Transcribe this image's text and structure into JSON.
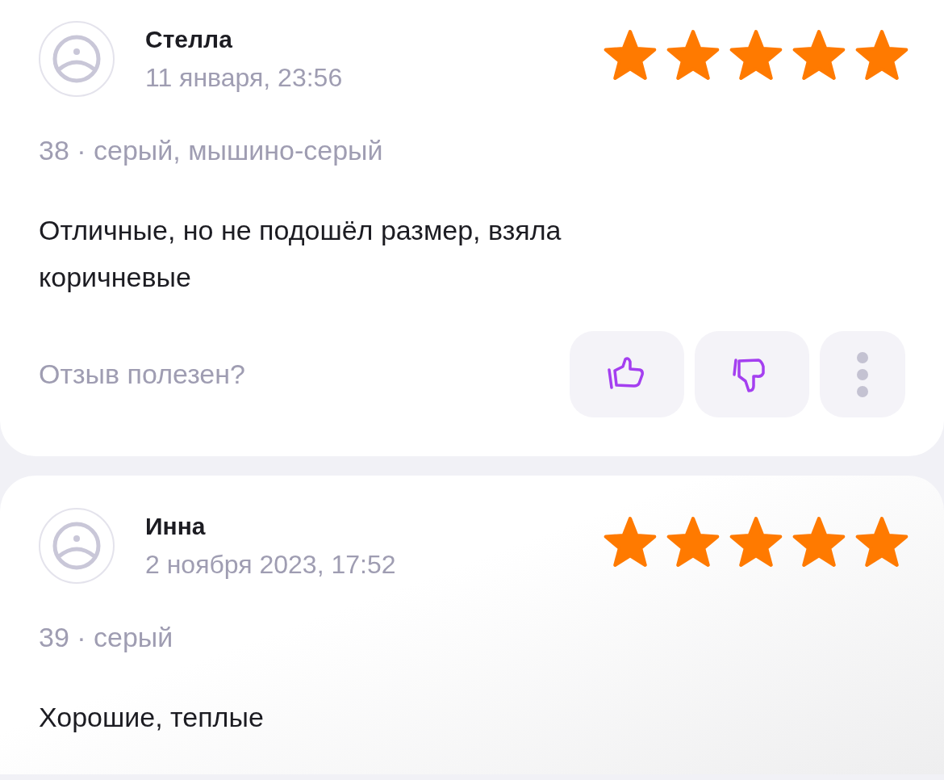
{
  "reviews": [
    {
      "author": "Стелла",
      "date": "11 января, 23:56",
      "stars": 5,
      "meta": "38 · серый, мышино-серый",
      "text": "Отличные, но не подошёл размер, взяла коричневые",
      "helpful_prompt": "Отзыв полезен?"
    },
    {
      "author": "Инна",
      "date": "2 ноября 2023, 17:52",
      "stars": 5,
      "meta": "39 · серый",
      "text": "Хорошие, теплые"
    }
  ]
}
